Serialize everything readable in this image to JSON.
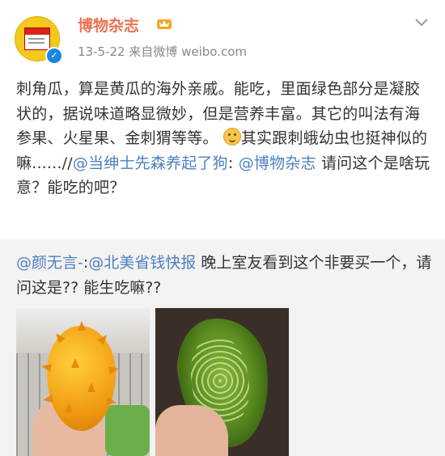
{
  "header": {
    "user_name": "博物杂志",
    "meta": "13-5-22  来自微博 weibo.com",
    "vip_badge_icon": "crown-badge-icon",
    "verified_icon": "verified-v-icon",
    "menu_icon": "chevron-down-icon"
  },
  "post": {
    "text_before_emoji": "刺角瓜，算是黄瓜的海外亲戚。能吃，里面绿色部分是凝胶状的，据说味道略显微妙，但是营养丰富。其它的叫法有海参果、火星果、金刺猬等等。",
    "emoji_icon": "smile-emoji-icon",
    "text_after_emoji": "其实跟刺蛾幼虫也挺神似的嘛......//",
    "mention1": "@当绅士先森养起了狗",
    "separator": ": ",
    "mention2": "@博物杂志",
    "text_end": " 请问这个是啥玩意？能吃的吧？"
  },
  "repost": {
    "mention1": "@颜无言-",
    "colon": ":",
    "mention2": "@北美省钱快报",
    "text": " 晚上室友看到这个非要买一个，请问这是?? 能生吃嘛??",
    "photos": [
      "kiwano-whole-photo",
      "kiwano-cut-photo"
    ]
  },
  "colors": {
    "name": "#eb7350",
    "link": "#4d7fc1",
    "meta": "#888888",
    "repost_bg": "#f3f3f3"
  }
}
